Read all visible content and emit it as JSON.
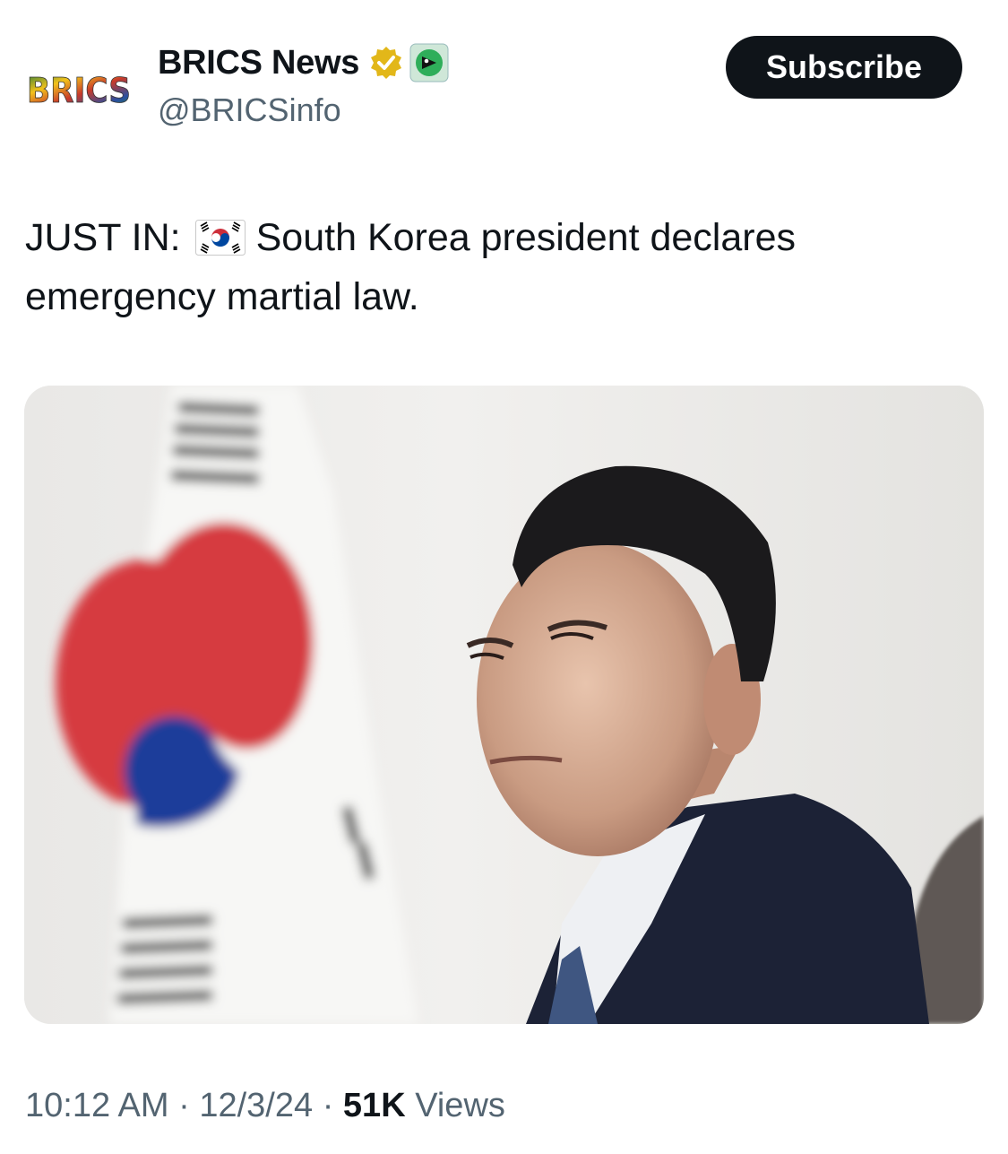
{
  "author": {
    "display_name": "BRICS News",
    "handle": "@BRICSinfo",
    "avatar_text": "BRICS",
    "verified_icon": "gold-verified-badge-icon",
    "affiliate_icon": "affiliate-badge-icon"
  },
  "actions": {
    "subscribe_label": "Subscribe"
  },
  "tweet": {
    "text_prefix": "JUST IN:",
    "flag_icon": "south-korea-flag-icon",
    "text_body": "South Korea president declares emergency martial law."
  },
  "media": {
    "type": "photo"
  },
  "meta": {
    "time": "10:12 AM",
    "separator": "·",
    "date": "12/3/24",
    "views_count": "51K",
    "views_label": "Views"
  },
  "colors": {
    "primary_text": "#0f1419",
    "secondary_text": "#536471",
    "subscribe_bg": "#0f1419",
    "verified_gold": "#e2b719"
  }
}
